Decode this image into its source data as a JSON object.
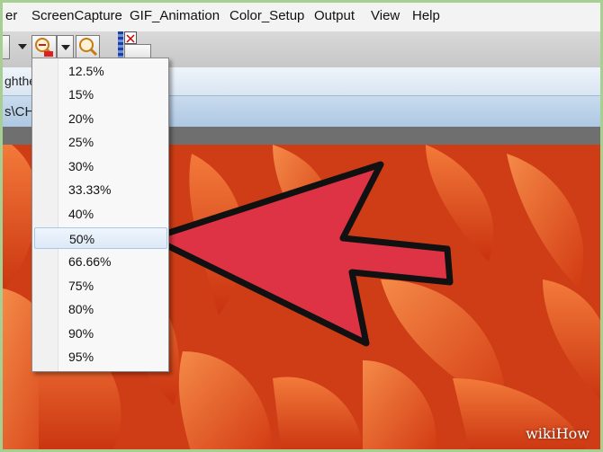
{
  "menu": {
    "items": [
      "er",
      "ScreenCapture",
      "GIF_Animation",
      "Color_Setup",
      "Output",
      "View",
      "Help"
    ]
  },
  "address": {
    "row1_text": "ghthe",
    "row2_text": "s\\CH"
  },
  "zoom": {
    "options": [
      "12.5%",
      "15%",
      "20%",
      "25%",
      "30%",
      "33.33%",
      "40%",
      "50%",
      "66.66%",
      "75%",
      "80%",
      "90%",
      "95%"
    ],
    "selected": "50%"
  },
  "icons": {
    "zoom_out": "zoom-out-magnifier-icon",
    "dropdown": "dropdown-arrow-icon",
    "zoom_in": "zoom-magnifier-icon",
    "close": "close-x-icon",
    "pointer": "red-pointing-arrow-icon"
  },
  "colors": {
    "arrow_fill": "#dd3344",
    "petal_base": "#d8471b"
  },
  "watermark": "wikiHow"
}
